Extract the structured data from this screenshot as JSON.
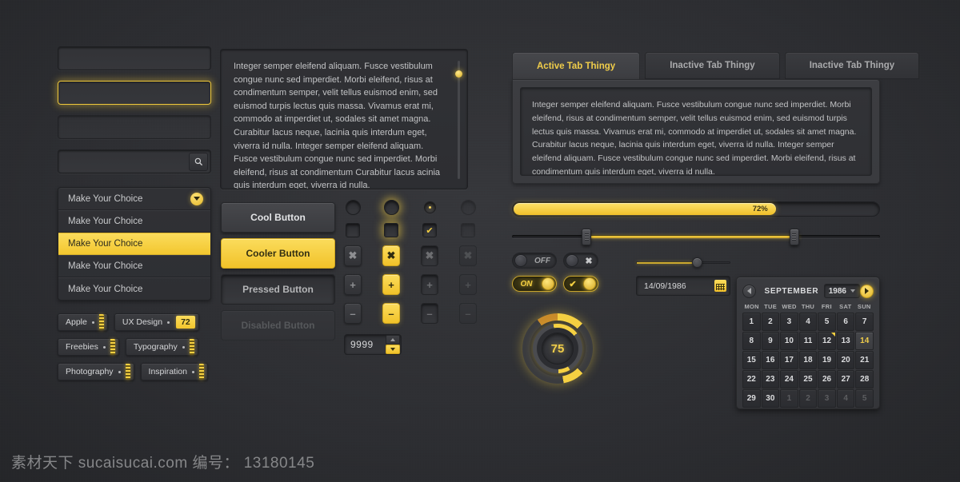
{
  "theme": {
    "background": "#2a2b2e",
    "accent": "#f5d042",
    "panel": "#3a3b3f",
    "field": "#323337",
    "text": "#c2c3c5"
  },
  "left_column": {
    "inputs": [
      {
        "name": "text-input-default",
        "value": "",
        "placeholder": "",
        "state": "default"
      },
      {
        "name": "text-input-focused",
        "value": "",
        "placeholder": "",
        "state": "focused"
      },
      {
        "name": "text-input-disabled",
        "value": "",
        "placeholder": "",
        "state": "disabled"
      }
    ],
    "search": {
      "value": "",
      "placeholder": "",
      "icon": "search-icon"
    },
    "dropdown": {
      "caret_icon": "chevron-down-icon",
      "items": [
        {
          "label": "Make Your Choice",
          "selected": false
        },
        {
          "label": "Make Your Choice",
          "selected": false
        },
        {
          "label": "Make Your Choice",
          "selected": true
        },
        {
          "label": "Make Your Choice",
          "selected": false
        },
        {
          "label": "Make Your Choice",
          "selected": false
        }
      ]
    },
    "tags": [
      {
        "label": "Apple",
        "count": ""
      },
      {
        "label": "UX Design",
        "count": "72"
      },
      {
        "label": "Freebies",
        "count": ""
      },
      {
        "label": "Typography",
        "count": ""
      },
      {
        "label": "Photography",
        "count": ""
      },
      {
        "label": "Inspiration",
        "count": ""
      }
    ]
  },
  "textarea_panel": {
    "text": "Integer semper eleifend aliquam. Fusce vestibulum congue nunc sed imperdiet. Morbi eleifend, risus at condimentum semper, velit tellus euismod enim, sed euismod turpis lectus quis massa. Vivamus erat mi, commodo at imperdiet ut, sodales sit amet magna. Curabitur lacus neque, lacinia quis interdum eget, viverra id nulla. Integer semper eleifend aliquam. Fusce vestibulum congue nunc sed imperdiet. Morbi eleifend, risus at condimentum Curabitur lacus acinia quis interdum eget, viverra id nulla.",
    "scrollbar": "scrollbar-thumb"
  },
  "buttons": [
    {
      "label": "Cool Button",
      "state": "normal"
    },
    {
      "label": "Cooler Button",
      "state": "primary"
    },
    {
      "label": "Pressed Button",
      "state": "pressed"
    },
    {
      "label": "Disabled Button",
      "state": "disabled"
    }
  ],
  "control_grid": {
    "radios": [
      "off",
      "off-highlighted",
      "on",
      "disabled"
    ],
    "checkboxes": [
      "off",
      "off-highlighted",
      "checked",
      "disabled"
    ],
    "icon_rows": [
      {
        "icon": "close-icon",
        "glyph": "✖",
        "states": [
          "normal",
          "active",
          "pressed",
          "disabled"
        ]
      },
      {
        "icon": "plus-icon",
        "glyph": "➕",
        "states": [
          "normal",
          "active",
          "pressed",
          "disabled"
        ]
      },
      {
        "icon": "minus-icon",
        "glyph": "➖",
        "states": [
          "normal",
          "active",
          "pressed",
          "disabled"
        ]
      }
    ],
    "check_glyph": "✔",
    "spinner": {
      "value": "9999",
      "up_icon": "caret-up-icon",
      "down_icon": "caret-down-icon"
    }
  },
  "tabs": {
    "items": [
      {
        "label": "Active Tab Thingy",
        "active": true
      },
      {
        "label": "Inactive Tab Thingy",
        "active": false
      },
      {
        "label": "Inactive Tab Thingy",
        "active": false
      }
    ],
    "content": "Integer semper eleifend aliquam. Fusce vestibulum congue nunc sed imperdiet. Morbi eleifend, risus at condimentum semper, velit tellus euismod enim, sed euismod turpis lectus quis massa. Vivamus erat mi, commodo at imperdiet ut, sodales sit amet magna. Curabitur lacus neque, lacinia quis interdum eget, viverra id nulla. Integer semper eleifend aliquam. Fusce vestibulum congue nunc sed imperdiet. Morbi eleifend, risus at condimentum quis interdum eget, viverra id nulla."
  },
  "progress": {
    "percent": 72,
    "label": "72%"
  },
  "range_slider": {
    "min_percent": 19,
    "max_percent": 78
  },
  "toggles": [
    {
      "name": "toggle-off-label",
      "state": "off",
      "label": "OFF"
    },
    {
      "name": "toggle-off-cross",
      "state": "off",
      "glyph": "✖"
    },
    {
      "name": "toggle-on-label",
      "state": "on",
      "label": "ON"
    },
    {
      "name": "toggle-on-check",
      "state": "on",
      "glyph": "✔"
    }
  ],
  "single_slider": {
    "percent": 64
  },
  "date_input": {
    "value": "14/09/1986",
    "icon": "calendar-icon"
  },
  "knob": {
    "value": "75"
  },
  "calendar": {
    "month": "SEPTEMBER",
    "year": "1986",
    "prev_icon": "caret-left-icon",
    "next_icon": "caret-right-icon",
    "weekdays": [
      "MON",
      "TUE",
      "WED",
      "THU",
      "FRI",
      "SAT",
      "SUN"
    ],
    "weeks": [
      [
        {
          "d": "1"
        },
        {
          "d": "2"
        },
        {
          "d": "3"
        },
        {
          "d": "4"
        },
        {
          "d": "5"
        },
        {
          "d": "6"
        },
        {
          "d": "7"
        }
      ],
      [
        {
          "d": "8"
        },
        {
          "d": "9"
        },
        {
          "d": "10"
        },
        {
          "d": "11"
        },
        {
          "d": "12",
          "mark": true
        },
        {
          "d": "13"
        },
        {
          "d": "14",
          "sel": true
        }
      ],
      [
        {
          "d": "15"
        },
        {
          "d": "16"
        },
        {
          "d": "17"
        },
        {
          "d": "18"
        },
        {
          "d": "19"
        },
        {
          "d": "20"
        },
        {
          "d": "21"
        }
      ],
      [
        {
          "d": "22"
        },
        {
          "d": "23"
        },
        {
          "d": "24"
        },
        {
          "d": "25"
        },
        {
          "d": "26"
        },
        {
          "d": "27"
        },
        {
          "d": "28"
        }
      ],
      [
        {
          "d": "29"
        },
        {
          "d": "30"
        },
        {
          "d": "1",
          "mute": true
        },
        {
          "d": "2",
          "mute": true
        },
        {
          "d": "3",
          "mute": true
        },
        {
          "d": "4",
          "mute": true
        },
        {
          "d": "5",
          "mute": true
        }
      ]
    ]
  },
  "watermark": {
    "text": "素材天下 sucaisucai.com  编号： 13180145"
  }
}
